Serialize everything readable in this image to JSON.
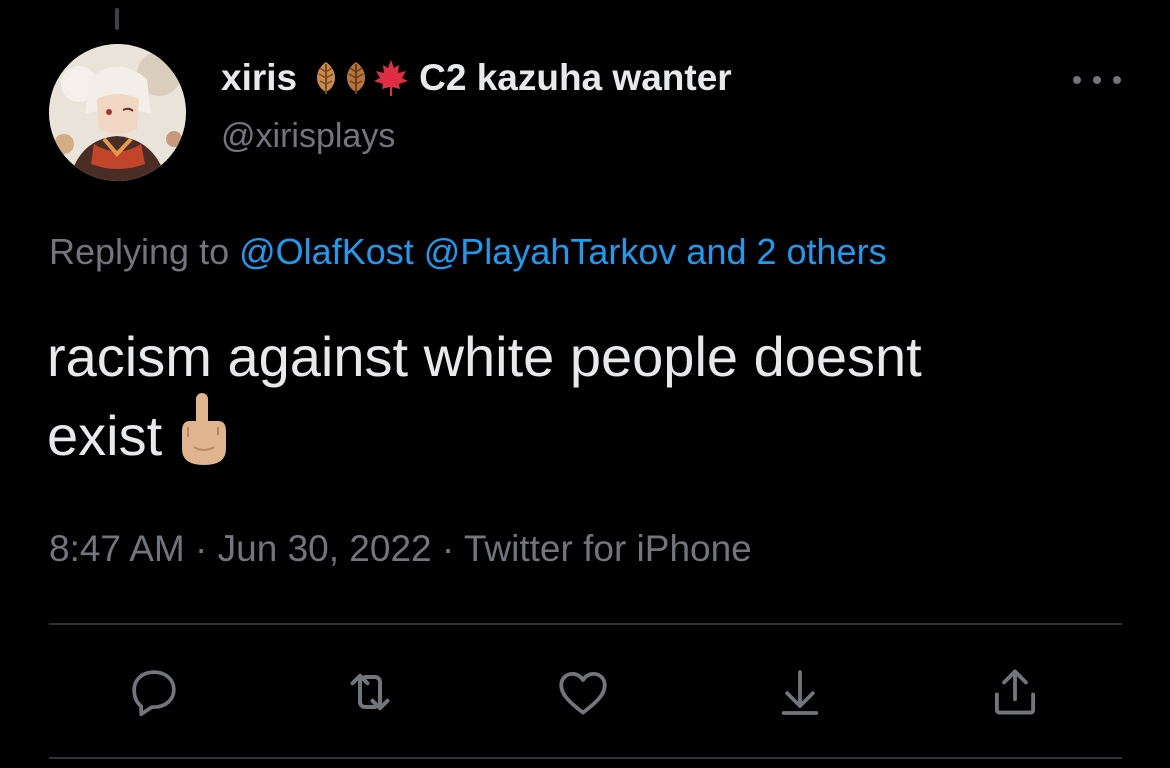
{
  "user": {
    "display_name": "xiris",
    "display_name_suffix": "C2 kazuha wanter",
    "name_emojis": [
      "fallen-leaf-emoji",
      "fallen-leaf-emoji",
      "maple-leaf-emoji"
    ],
    "handle": "@xirisplays"
  },
  "reply": {
    "prefix": "Replying to",
    "mentions": [
      "@OlafKost",
      "@PlayahTarkov"
    ],
    "others": "and 2 others"
  },
  "tweet": {
    "text_line1": "racism against white people doesnt",
    "text_line2": "exist",
    "emoji": "middle-finger-emoji"
  },
  "meta": {
    "time": "8:47 AM",
    "separator": " · ",
    "date": "Jun 30, 2022",
    "source": "Twitter for iPhone"
  },
  "colors": {
    "background": "#000000",
    "text": "#e7e9ea",
    "secondary": "#71767b",
    "link": "#1d9bf0",
    "divider": "#2f3336"
  },
  "actions": [
    "reply-icon",
    "retweet-icon",
    "like-icon",
    "bookmark-icon",
    "share-icon"
  ]
}
